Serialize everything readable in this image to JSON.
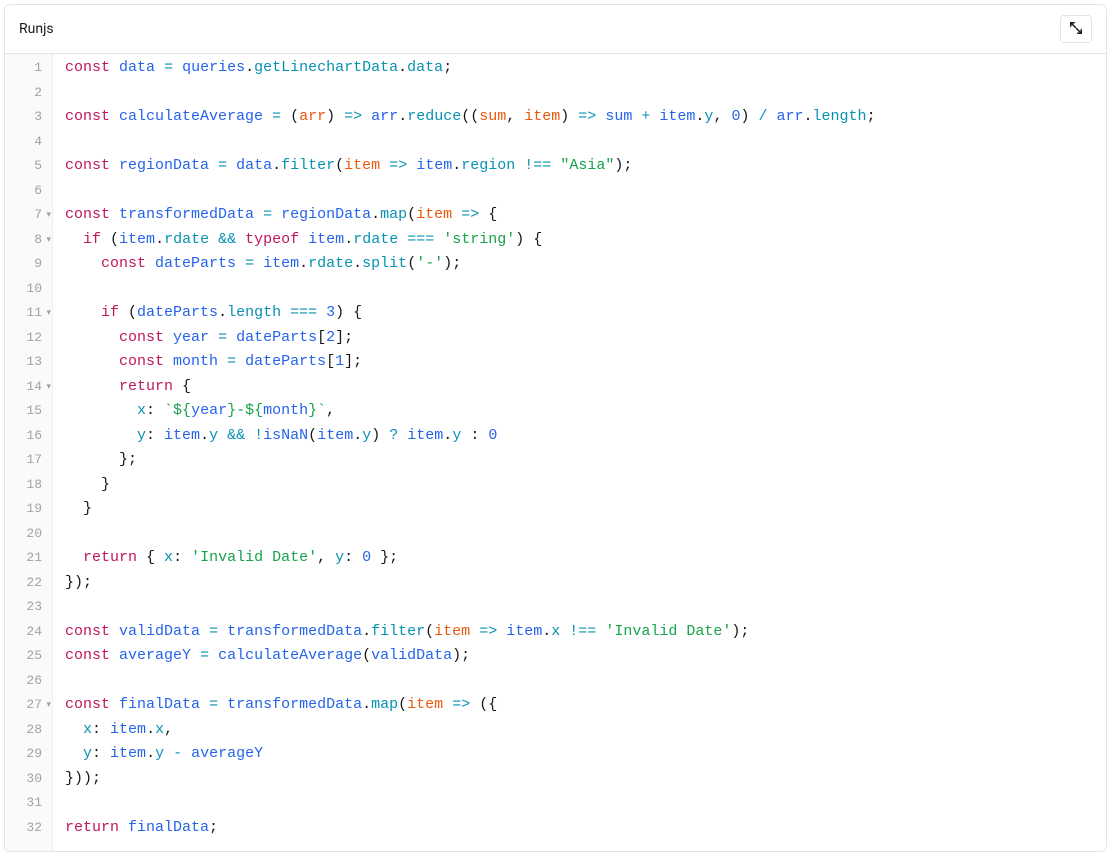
{
  "header": {
    "tab_label": "Runjs",
    "expand_icon": "expand-icon"
  },
  "editor": {
    "fold_lines": [
      7,
      8,
      11,
      14,
      27
    ],
    "lines": [
      [
        [
          "kw",
          "const"
        ],
        [
          "plain",
          " "
        ],
        [
          "def",
          "data"
        ],
        [
          "plain",
          " "
        ],
        [
          "op",
          "="
        ],
        [
          "plain",
          " "
        ],
        [
          "def",
          "queries"
        ],
        [
          "plain",
          "."
        ],
        [
          "fn",
          "getLinechartData"
        ],
        [
          "plain",
          "."
        ],
        [
          "fn",
          "data"
        ],
        [
          "plain",
          ";"
        ]
      ],
      [],
      [
        [
          "kw",
          "const"
        ],
        [
          "plain",
          " "
        ],
        [
          "def",
          "calculateAverage"
        ],
        [
          "plain",
          " "
        ],
        [
          "op",
          "="
        ],
        [
          "plain",
          " ("
        ],
        [
          "arg",
          "arr"
        ],
        [
          "plain",
          ") "
        ],
        [
          "op",
          "=>"
        ],
        [
          "plain",
          " "
        ],
        [
          "def",
          "arr"
        ],
        [
          "plain",
          "."
        ],
        [
          "fn",
          "reduce"
        ],
        [
          "plain",
          "(("
        ],
        [
          "arg",
          "sum"
        ],
        [
          "plain",
          ", "
        ],
        [
          "arg",
          "item"
        ],
        [
          "plain",
          ") "
        ],
        [
          "op",
          "=>"
        ],
        [
          "plain",
          " "
        ],
        [
          "def",
          "sum"
        ],
        [
          "plain",
          " "
        ],
        [
          "op",
          "+"
        ],
        [
          "plain",
          " "
        ],
        [
          "def",
          "item"
        ],
        [
          "plain",
          "."
        ],
        [
          "fn",
          "y"
        ],
        [
          "plain",
          ", "
        ],
        [
          "num",
          "0"
        ],
        [
          "plain",
          ") "
        ],
        [
          "op",
          "/"
        ],
        [
          "plain",
          " "
        ],
        [
          "def",
          "arr"
        ],
        [
          "plain",
          "."
        ],
        [
          "fn",
          "length"
        ],
        [
          "plain",
          ";"
        ]
      ],
      [],
      [
        [
          "kw",
          "const"
        ],
        [
          "plain",
          " "
        ],
        [
          "def",
          "regionData"
        ],
        [
          "plain",
          " "
        ],
        [
          "op",
          "="
        ],
        [
          "plain",
          " "
        ],
        [
          "def",
          "data"
        ],
        [
          "plain",
          "."
        ],
        [
          "fn",
          "filter"
        ],
        [
          "plain",
          "("
        ],
        [
          "arg",
          "item"
        ],
        [
          "plain",
          " "
        ],
        [
          "op",
          "=>"
        ],
        [
          "plain",
          " "
        ],
        [
          "def",
          "item"
        ],
        [
          "plain",
          "."
        ],
        [
          "fn",
          "region"
        ],
        [
          "plain",
          " "
        ],
        [
          "op",
          "!=="
        ],
        [
          "plain",
          " "
        ],
        [
          "str",
          "\"Asia\""
        ],
        [
          "plain",
          ");"
        ]
      ],
      [],
      [
        [
          "kw",
          "const"
        ],
        [
          "plain",
          " "
        ],
        [
          "def",
          "transformedData"
        ],
        [
          "plain",
          " "
        ],
        [
          "op",
          "="
        ],
        [
          "plain",
          " "
        ],
        [
          "def",
          "regionData"
        ],
        [
          "plain",
          "."
        ],
        [
          "fn",
          "map"
        ],
        [
          "plain",
          "("
        ],
        [
          "arg",
          "item"
        ],
        [
          "plain",
          " "
        ],
        [
          "op",
          "=>"
        ],
        [
          "plain",
          " {"
        ]
      ],
      [
        [
          "plain",
          "  "
        ],
        [
          "kw",
          "if"
        ],
        [
          "plain",
          " ("
        ],
        [
          "def",
          "item"
        ],
        [
          "plain",
          "."
        ],
        [
          "fn",
          "rdate"
        ],
        [
          "plain",
          " "
        ],
        [
          "op",
          "&&"
        ],
        [
          "plain",
          " "
        ],
        [
          "kw",
          "typeof"
        ],
        [
          "plain",
          " "
        ],
        [
          "def",
          "item"
        ],
        [
          "plain",
          "."
        ],
        [
          "fn",
          "rdate"
        ],
        [
          "plain",
          " "
        ],
        [
          "op",
          "==="
        ],
        [
          "plain",
          " "
        ],
        [
          "str",
          "'string'"
        ],
        [
          "plain",
          ") {"
        ]
      ],
      [
        [
          "plain",
          "    "
        ],
        [
          "kw",
          "const"
        ],
        [
          "plain",
          " "
        ],
        [
          "def",
          "dateParts"
        ],
        [
          "plain",
          " "
        ],
        [
          "op",
          "="
        ],
        [
          "plain",
          " "
        ],
        [
          "def",
          "item"
        ],
        [
          "plain",
          "."
        ],
        [
          "fn",
          "rdate"
        ],
        [
          "plain",
          "."
        ],
        [
          "fn",
          "split"
        ],
        [
          "plain",
          "("
        ],
        [
          "str",
          "'-'"
        ],
        [
          "plain",
          ");"
        ]
      ],
      [],
      [
        [
          "plain",
          "    "
        ],
        [
          "kw",
          "if"
        ],
        [
          "plain",
          " ("
        ],
        [
          "def",
          "dateParts"
        ],
        [
          "plain",
          "."
        ],
        [
          "fn",
          "length"
        ],
        [
          "plain",
          " "
        ],
        [
          "op",
          "==="
        ],
        [
          "plain",
          " "
        ],
        [
          "num",
          "3"
        ],
        [
          "plain",
          ") {"
        ]
      ],
      [
        [
          "plain",
          "      "
        ],
        [
          "kw",
          "const"
        ],
        [
          "plain",
          " "
        ],
        [
          "def",
          "year"
        ],
        [
          "plain",
          " "
        ],
        [
          "op",
          "="
        ],
        [
          "plain",
          " "
        ],
        [
          "def",
          "dateParts"
        ],
        [
          "plain",
          "["
        ],
        [
          "num",
          "2"
        ],
        [
          "plain",
          "];"
        ]
      ],
      [
        [
          "plain",
          "      "
        ],
        [
          "kw",
          "const"
        ],
        [
          "plain",
          " "
        ],
        [
          "def",
          "month"
        ],
        [
          "plain",
          " "
        ],
        [
          "op",
          "="
        ],
        [
          "plain",
          " "
        ],
        [
          "def",
          "dateParts"
        ],
        [
          "plain",
          "["
        ],
        [
          "num",
          "1"
        ],
        [
          "plain",
          "];"
        ]
      ],
      [
        [
          "plain",
          "      "
        ],
        [
          "kw",
          "return"
        ],
        [
          "plain",
          " {"
        ]
      ],
      [
        [
          "plain",
          "        "
        ],
        [
          "fn",
          "x"
        ],
        [
          "plain",
          ": "
        ],
        [
          "str",
          "`${"
        ],
        [
          "tmpl",
          "year"
        ],
        [
          "str",
          "}-${"
        ],
        [
          "tmpl",
          "month"
        ],
        [
          "str",
          "}`"
        ],
        [
          "plain",
          ","
        ]
      ],
      [
        [
          "plain",
          "        "
        ],
        [
          "fn",
          "y"
        ],
        [
          "plain",
          ": "
        ],
        [
          "def",
          "item"
        ],
        [
          "plain",
          "."
        ],
        [
          "fn",
          "y"
        ],
        [
          "plain",
          " "
        ],
        [
          "op",
          "&&"
        ],
        [
          "plain",
          " "
        ],
        [
          "op",
          "!"
        ],
        [
          "def",
          "isNaN"
        ],
        [
          "plain",
          "("
        ],
        [
          "def",
          "item"
        ],
        [
          "plain",
          "."
        ],
        [
          "fn",
          "y"
        ],
        [
          "plain",
          ") "
        ],
        [
          "op",
          "?"
        ],
        [
          "plain",
          " "
        ],
        [
          "def",
          "item"
        ],
        [
          "plain",
          "."
        ],
        [
          "fn",
          "y"
        ],
        [
          "plain",
          " : "
        ],
        [
          "num",
          "0"
        ]
      ],
      [
        [
          "plain",
          "      };"
        ]
      ],
      [
        [
          "plain",
          "    }"
        ]
      ],
      [
        [
          "plain",
          "  }"
        ]
      ],
      [],
      [
        [
          "plain",
          "  "
        ],
        [
          "kw",
          "return"
        ],
        [
          "plain",
          " { "
        ],
        [
          "fn",
          "x"
        ],
        [
          "plain",
          ": "
        ],
        [
          "str",
          "'Invalid Date'"
        ],
        [
          "plain",
          ", "
        ],
        [
          "fn",
          "y"
        ],
        [
          "plain",
          ": "
        ],
        [
          "num",
          "0"
        ],
        [
          "plain",
          " };"
        ]
      ],
      [
        [
          "plain",
          "});"
        ]
      ],
      [],
      [
        [
          "kw",
          "const"
        ],
        [
          "plain",
          " "
        ],
        [
          "def",
          "validData"
        ],
        [
          "plain",
          " "
        ],
        [
          "op",
          "="
        ],
        [
          "plain",
          " "
        ],
        [
          "def",
          "transformedData"
        ],
        [
          "plain",
          "."
        ],
        [
          "fn",
          "filter"
        ],
        [
          "plain",
          "("
        ],
        [
          "arg",
          "item"
        ],
        [
          "plain",
          " "
        ],
        [
          "op",
          "=>"
        ],
        [
          "plain",
          " "
        ],
        [
          "def",
          "item"
        ],
        [
          "plain",
          "."
        ],
        [
          "fn",
          "x"
        ],
        [
          "plain",
          " "
        ],
        [
          "op",
          "!=="
        ],
        [
          "plain",
          " "
        ],
        [
          "str",
          "'Invalid Date'"
        ],
        [
          "plain",
          ");"
        ]
      ],
      [
        [
          "kw",
          "const"
        ],
        [
          "plain",
          " "
        ],
        [
          "def",
          "averageY"
        ],
        [
          "plain",
          " "
        ],
        [
          "op",
          "="
        ],
        [
          "plain",
          " "
        ],
        [
          "def",
          "calculateAverage"
        ],
        [
          "plain",
          "("
        ],
        [
          "def",
          "validData"
        ],
        [
          "plain",
          ");"
        ]
      ],
      [],
      [
        [
          "kw",
          "const"
        ],
        [
          "plain",
          " "
        ],
        [
          "def",
          "finalData"
        ],
        [
          "plain",
          " "
        ],
        [
          "op",
          "="
        ],
        [
          "plain",
          " "
        ],
        [
          "def",
          "transformedData"
        ],
        [
          "plain",
          "."
        ],
        [
          "fn",
          "map"
        ],
        [
          "plain",
          "("
        ],
        [
          "arg",
          "item"
        ],
        [
          "plain",
          " "
        ],
        [
          "op",
          "=>"
        ],
        [
          "plain",
          " ({"
        ]
      ],
      [
        [
          "plain",
          "  "
        ],
        [
          "fn",
          "x"
        ],
        [
          "plain",
          ": "
        ],
        [
          "def",
          "item"
        ],
        [
          "plain",
          "."
        ],
        [
          "fn",
          "x"
        ],
        [
          "plain",
          ","
        ]
      ],
      [
        [
          "plain",
          "  "
        ],
        [
          "fn",
          "y"
        ],
        [
          "plain",
          ": "
        ],
        [
          "def",
          "item"
        ],
        [
          "plain",
          "."
        ],
        [
          "fn",
          "y"
        ],
        [
          "plain",
          " "
        ],
        [
          "op",
          "-"
        ],
        [
          "plain",
          " "
        ],
        [
          "def",
          "averageY"
        ]
      ],
      [
        [
          "plain",
          "}));"
        ]
      ],
      [],
      [
        [
          "kw",
          "return"
        ],
        [
          "plain",
          " "
        ],
        [
          "def",
          "finalData"
        ],
        [
          "plain",
          ";"
        ]
      ]
    ]
  }
}
